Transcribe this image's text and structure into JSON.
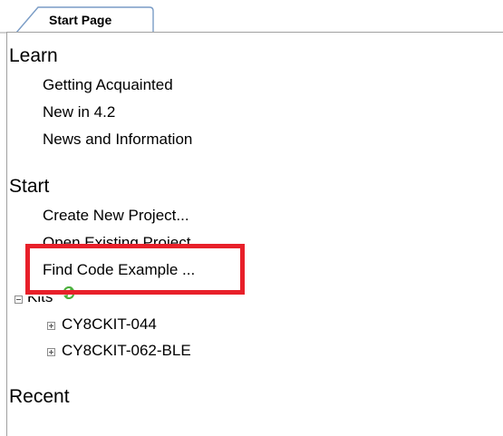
{
  "tab": {
    "title": "Start Page"
  },
  "learn": {
    "heading": "Learn",
    "items": [
      {
        "label": "Getting Acquainted"
      },
      {
        "label": "New in 4.2"
      },
      {
        "label": "News and Information"
      }
    ]
  },
  "start": {
    "heading": "Start",
    "items": [
      {
        "label": "Create New Project..."
      },
      {
        "label": "Open Existing Project..."
      },
      {
        "label": "Find Code Example ..."
      }
    ]
  },
  "kits": {
    "label": "Kits",
    "refresh_icon": "refresh-icon",
    "items": [
      {
        "label": "CY8CKIT-044"
      },
      {
        "label": "CY8CKIT-062-BLE"
      }
    ]
  },
  "recent": {
    "heading": "Recent"
  },
  "colors": {
    "highlight": "#e8202a",
    "tab_border": "#4a7ebb",
    "refresh_icon": "#4caf3c"
  }
}
